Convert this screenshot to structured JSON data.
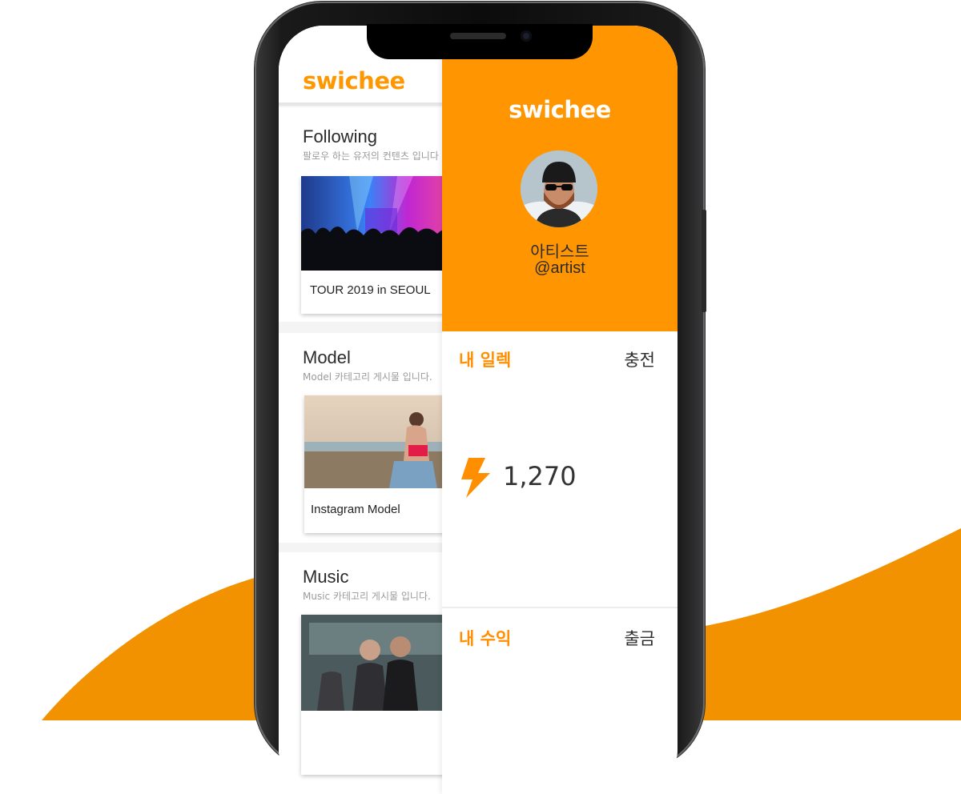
{
  "colors": {
    "accent": "#ff9500",
    "accent_text": "#ff8f00",
    "text_dark": "#2b2b2b",
    "muted": "#9a9a9a"
  },
  "feed": {
    "logo": "swichee",
    "sections": [
      {
        "title": "Following",
        "subtitle": "팔로우 하는 유저의 컨텐츠 입니다",
        "card_label": "TOUR 2019 in SEOUL"
      },
      {
        "title": "Model",
        "subtitle": "Model 카테고리 게시물 입니다.",
        "card_label": "Instagram Model"
      },
      {
        "title": "Music",
        "subtitle": "Music  카테고리 게시물 입니다.",
        "card_label": ""
      }
    ]
  },
  "drawer": {
    "logo": "swichee",
    "profile": {
      "name": "아티스트",
      "handle": "@artist"
    },
    "elec": {
      "title": "내 일렉",
      "action": "충전",
      "value": "1,270",
      "icon": "lightning-icon"
    },
    "earnings": {
      "title": "내 수익",
      "action": "출금"
    }
  }
}
